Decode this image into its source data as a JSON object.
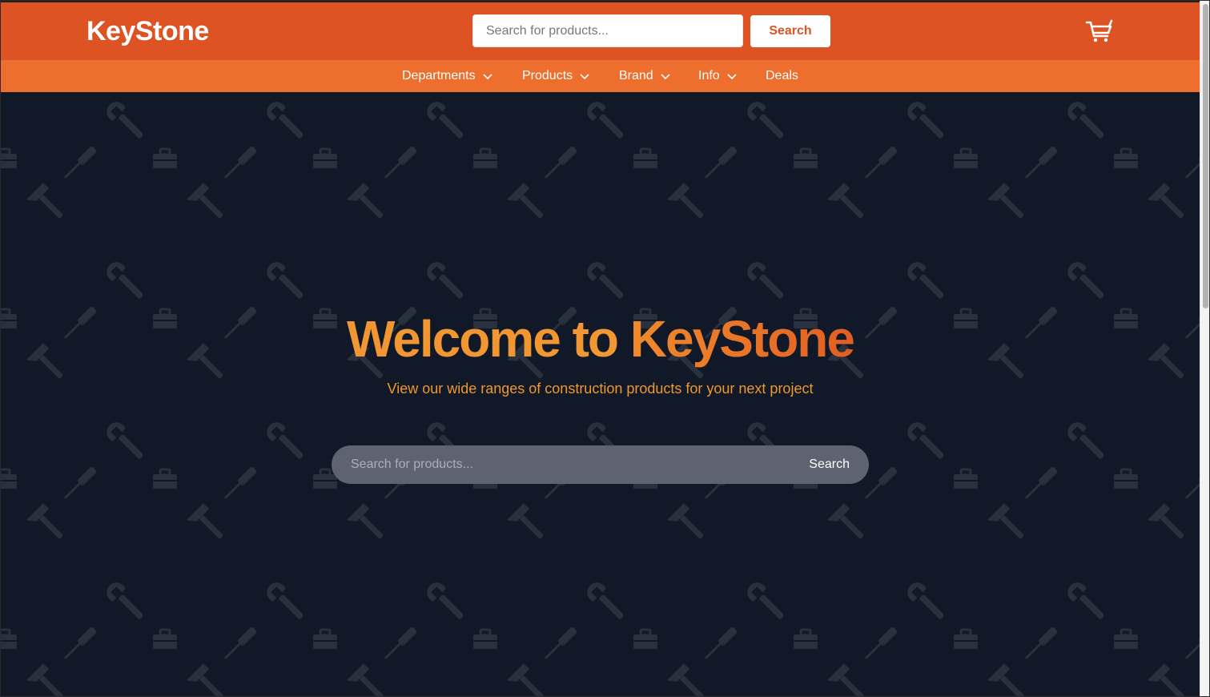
{
  "header": {
    "logo": "KeyStone",
    "search_placeholder": "Search for products...",
    "search_button": "Search",
    "cart_icon": "cart-icon"
  },
  "nav": {
    "items": [
      {
        "label": "Departments",
        "has_dropdown": true
      },
      {
        "label": "Products",
        "has_dropdown": true
      },
      {
        "label": "Brand",
        "has_dropdown": true
      },
      {
        "label": "Info",
        "has_dropdown": true
      },
      {
        "label": "Deals",
        "has_dropdown": false
      }
    ]
  },
  "hero": {
    "title_part1": "Welcome to",
    "title_part2": "KeyStone",
    "subtitle": "View our wide ranges of construction products for your next project",
    "search_placeholder": "Search for products...",
    "search_button": "Search",
    "pattern_icons": [
      "wrench-icon",
      "screwdriver-icon",
      "toolbox-icon",
      "hammer-icon"
    ]
  },
  "colors": {
    "header_bg": "#dd5323",
    "nav_bg": "#ee6e2d",
    "hero_bg": "#111827",
    "accent": "#f09632",
    "pattern": "#2a313e"
  }
}
